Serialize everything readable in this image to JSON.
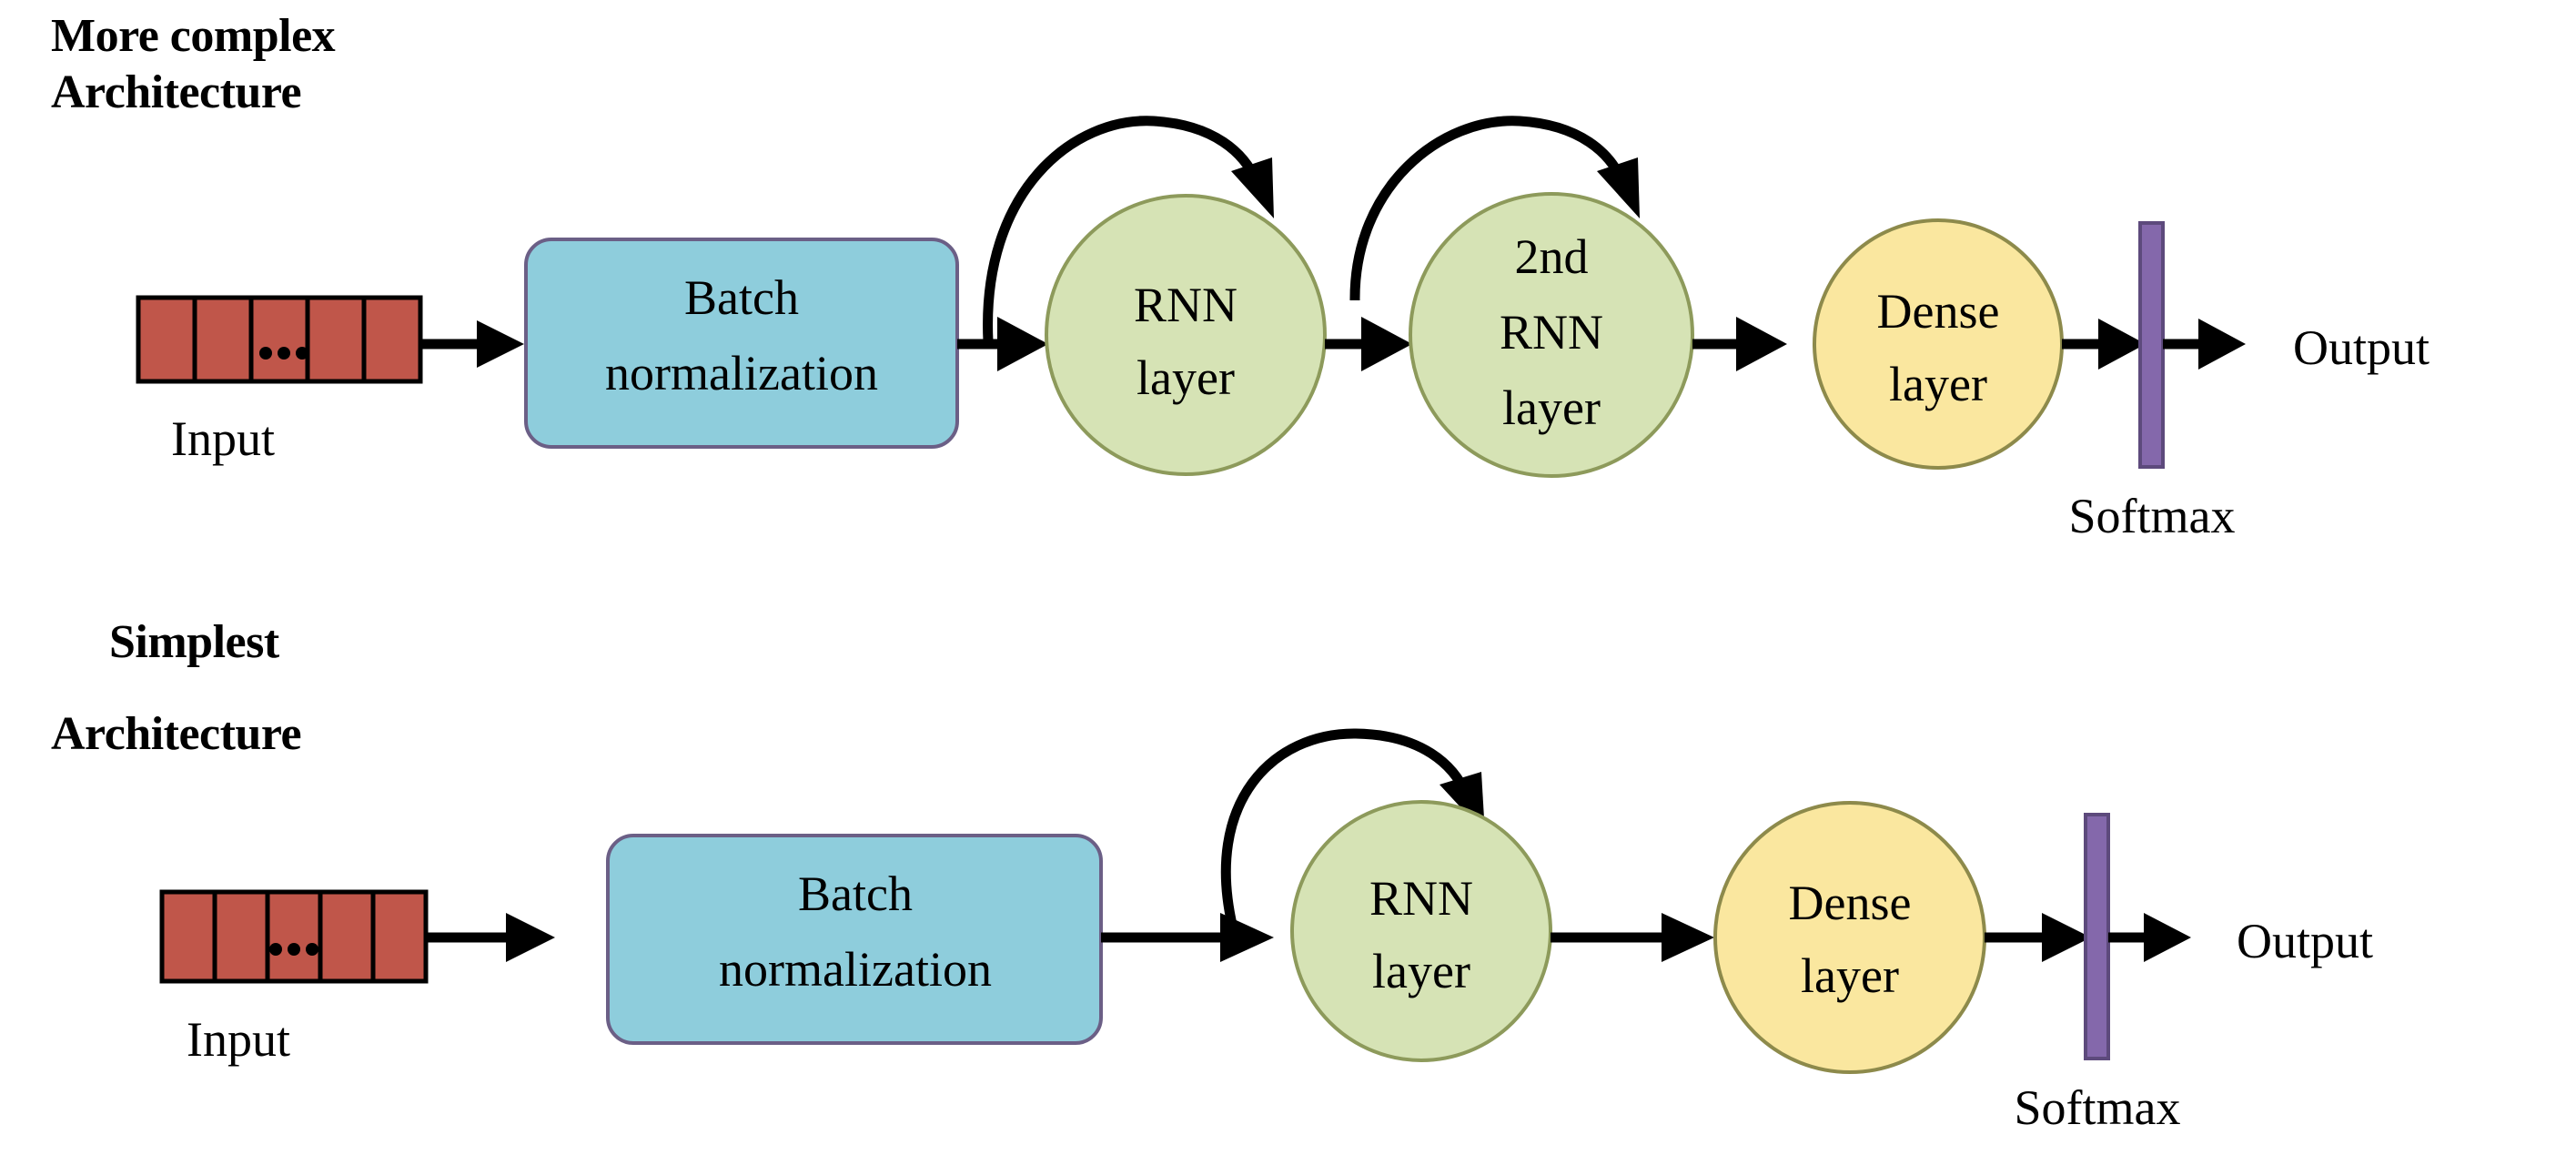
{
  "diagram": {
    "title_top": {
      "line1": "More complex",
      "line2": "Architecture"
    },
    "title_bottom": {
      "line1": "Simplest",
      "line2": "Architecture"
    },
    "colors": {
      "input_cell": "#c0564a",
      "batch_norm": "#8ecddc",
      "rnn": "#d6e3b5",
      "dense": "#fae79f",
      "softmax": "#8468ab",
      "stroke": "#000000",
      "background": "#ffffff"
    },
    "top_row": {
      "input_label": "Input",
      "input_ellipsis": "...",
      "input_cell_count": 5,
      "batch_norm": {
        "line1": "Batch",
        "line2": "normalization"
      },
      "rnn1": {
        "line1": "RNN",
        "line2": "layer"
      },
      "rnn2": {
        "line1": "2nd",
        "line2": "RNN",
        "line3": "layer"
      },
      "dense": {
        "line1": "Dense",
        "line2": "layer"
      },
      "softmax_label": "Softmax",
      "output_label": "Output"
    },
    "bottom_row": {
      "input_label": "Input",
      "input_ellipsis": "...",
      "input_cell_count": 5,
      "batch_norm": {
        "line1": "Batch",
        "line2": "normalization"
      },
      "rnn1": {
        "line1": "RNN",
        "line2": "layer"
      },
      "dense": {
        "line1": "Dense",
        "line2": "layer"
      },
      "softmax_label": "Softmax",
      "output_label": "Output"
    }
  }
}
